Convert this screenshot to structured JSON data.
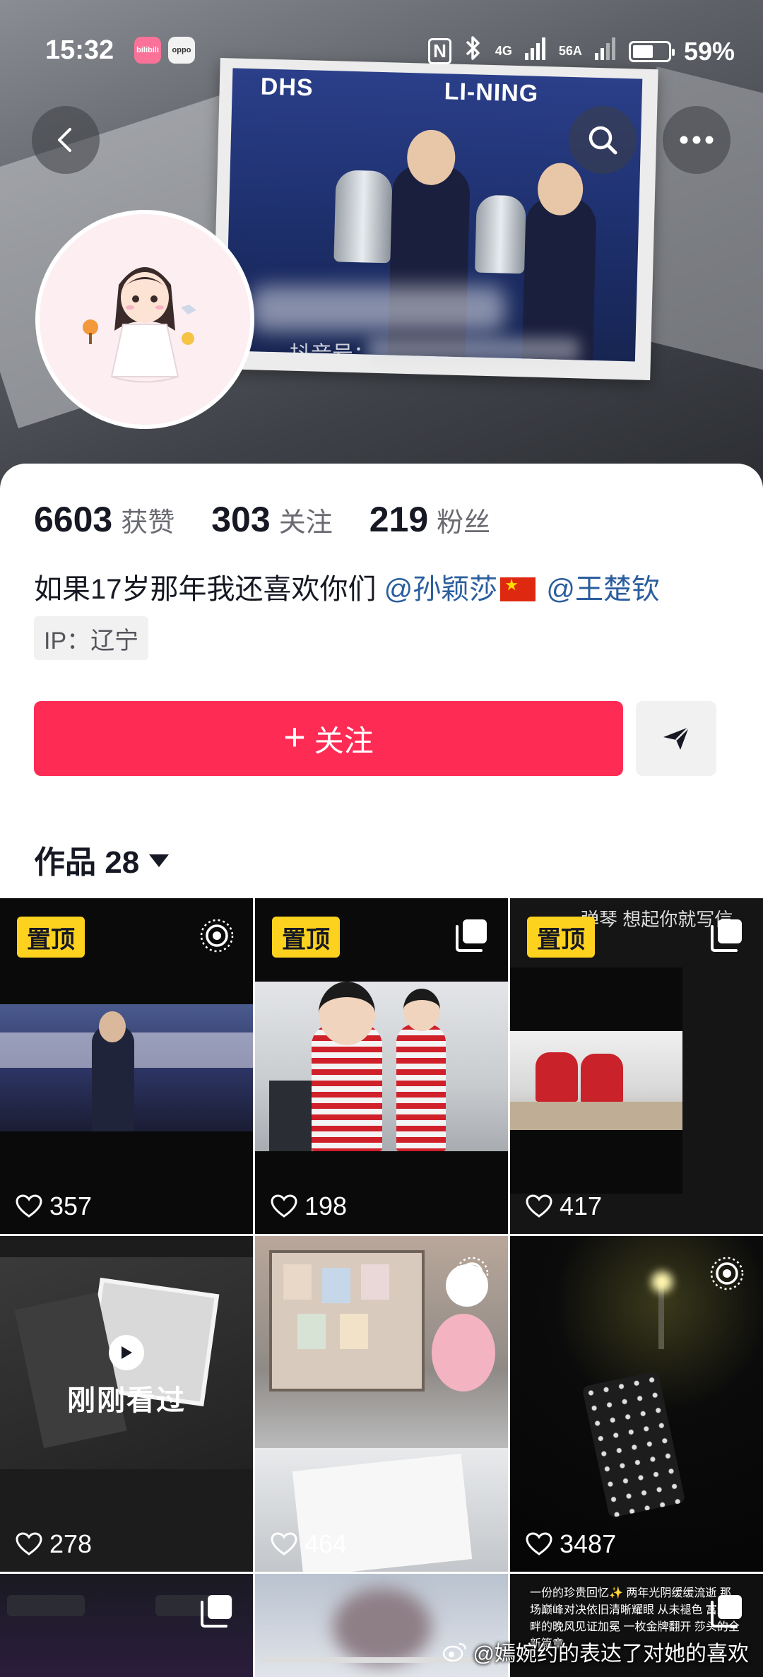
{
  "status_bar": {
    "time": "15:32",
    "app_badges": [
      "bilibili",
      "oppo"
    ],
    "nfc": "N",
    "network": "4G",
    "speed": "56A",
    "battery_percent": "59%",
    "battery_level": 0.59
  },
  "cover": {
    "photo_sponsors": [
      "DHS",
      "LI-NING"
    ],
    "douyin_id_label": "抖音号："
  },
  "header_buttons": {
    "back_icon": "chevron-left-icon",
    "search_icon": "search-icon",
    "more_icon": "more-horizontal-icon"
  },
  "profile": {
    "stats": [
      {
        "value": "6603",
        "label": "获赞"
      },
      {
        "value": "303",
        "label": "关注"
      },
      {
        "value": "219",
        "label": "粉丝"
      }
    ],
    "bio_text": "如果17岁那年我还喜欢你们",
    "mention_1": "@孙颖莎",
    "mention_2": "@王楚钦",
    "ip": "IP：辽宁",
    "follow_label": "关注"
  },
  "works_tab": {
    "label": "作品 28"
  },
  "grid": {
    "pinned_label": "置顶",
    "recently_viewed_label": "刚刚看过",
    "tiles": [
      {
        "likes": "357",
        "pinned": true
      },
      {
        "likes": "198",
        "pinned": true
      },
      {
        "likes": "417",
        "pinned": true
      },
      {
        "likes": "278",
        "pinned": false
      },
      {
        "likes": "464",
        "pinned": false
      },
      {
        "likes": "3487",
        "pinned": false
      }
    ],
    "tile3_overlay_text": "弹琴 想起你就写信",
    "tile9_caption": "一份的珍贵回忆✨ 两年光阴缓缓流逝 那场巅峰对决依旧清晰耀眼 从未褪色 富纳河畔的晚风见证加冕 一枚金牌翻开 莎头的全新篇章"
  },
  "watermark": "@嫣婉约的表达了对她的喜欢",
  "colors": {
    "follow_red": "#fe2c55",
    "pin_yellow": "#fdd21f",
    "mention_blue": "#2b5e9e"
  }
}
